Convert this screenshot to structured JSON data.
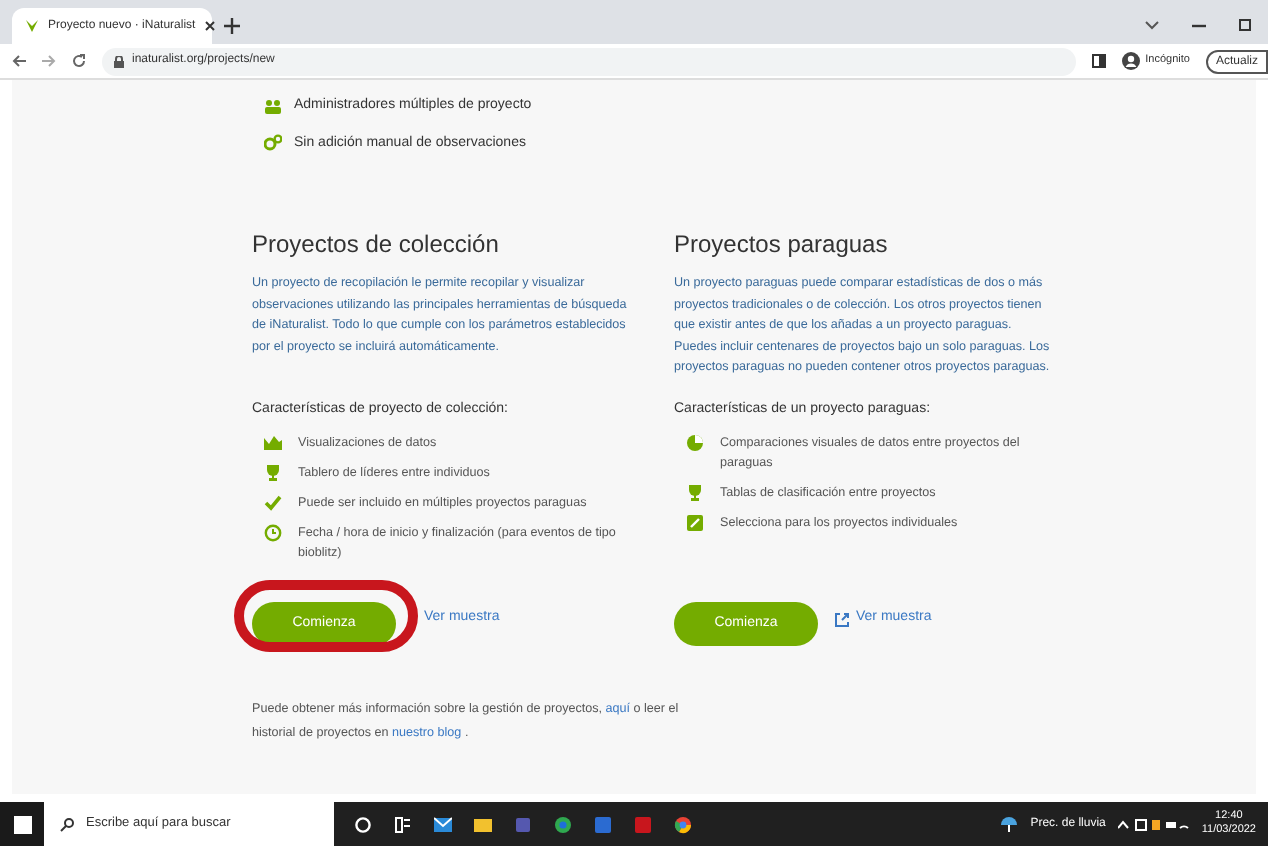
{
  "browser": {
    "tab_title": "Proyecto nuevo · iNaturalist",
    "url": "inaturalist.org/projects/new",
    "profile": "Incógnito",
    "update_button": "Actualiz"
  },
  "top_features": [
    "Administradores múltiples de proyecto",
    "Sin adición manual de observaciones"
  ],
  "columns": [
    {
      "title": "Proyectos de colección",
      "description": "Un proyecto de recopilación le permite recopilar y visualizar observaciones utilizando las principales herramientas de búsqueda de iNaturalist. Todo lo que cumple con los parámetros establecidos por el proyecto se incluirá automáticamente.",
      "features_heading": "Características de proyecto de colección:",
      "features": [
        "Visualizaciones de datos",
        "Tablero de líderes entre individuos",
        "Puede ser incluido en múltiples proyectos paraguas",
        "Fecha / hora de inicio y finalización (para eventos de tipo bioblitz)"
      ],
      "start_button": {
        "label": "Comienza",
        "circled": true
      },
      "sample_link": {
        "label": "Ver muestra",
        "external": false
      }
    },
    {
      "title": "Proyectos paraguas",
      "description": "Un proyecto paraguas puede comparar estadísticas de dos o más proyectos tradicionales o de colección. Los otros proyectos tienen que existir antes de que los añadas a un proyecto paraguas. Puedes incluir centenares de proyectos bajo un solo paraguas. Los proyectos paraguas no pueden contener otros proyectos paraguas.",
      "features_heading": "Características de un proyecto paraguas:",
      "features": [
        "Comparaciones visuales de datos entre proyectos del paraguas",
        "Tablas de clasificación entre proyectos",
        "Selecciona para los proyectos individuales"
      ],
      "start_button": {
        "label": "Comienza",
        "circled": false
      },
      "sample_link": {
        "label": "Ver muestra",
        "external": true
      }
    }
  ],
  "footer": [
    {
      "kind": "text",
      "text": "Puede obtener más información sobre la gestión de proyectos,"
    },
    {
      "kind": "link",
      "text": "aquí"
    },
    {
      "kind": "text",
      "text": "o leer el historial de proyectos en"
    },
    {
      "kind": "link",
      "text": "nuestro blog"
    },
    {
      "kind": "text",
      "text": "."
    }
  ],
  "taskbar": {
    "search_placeholder": "Escribe aquí para buscar",
    "weather": "Prec. de lluvia",
    "time": "12:40",
    "date": "11/03/2022"
  }
}
